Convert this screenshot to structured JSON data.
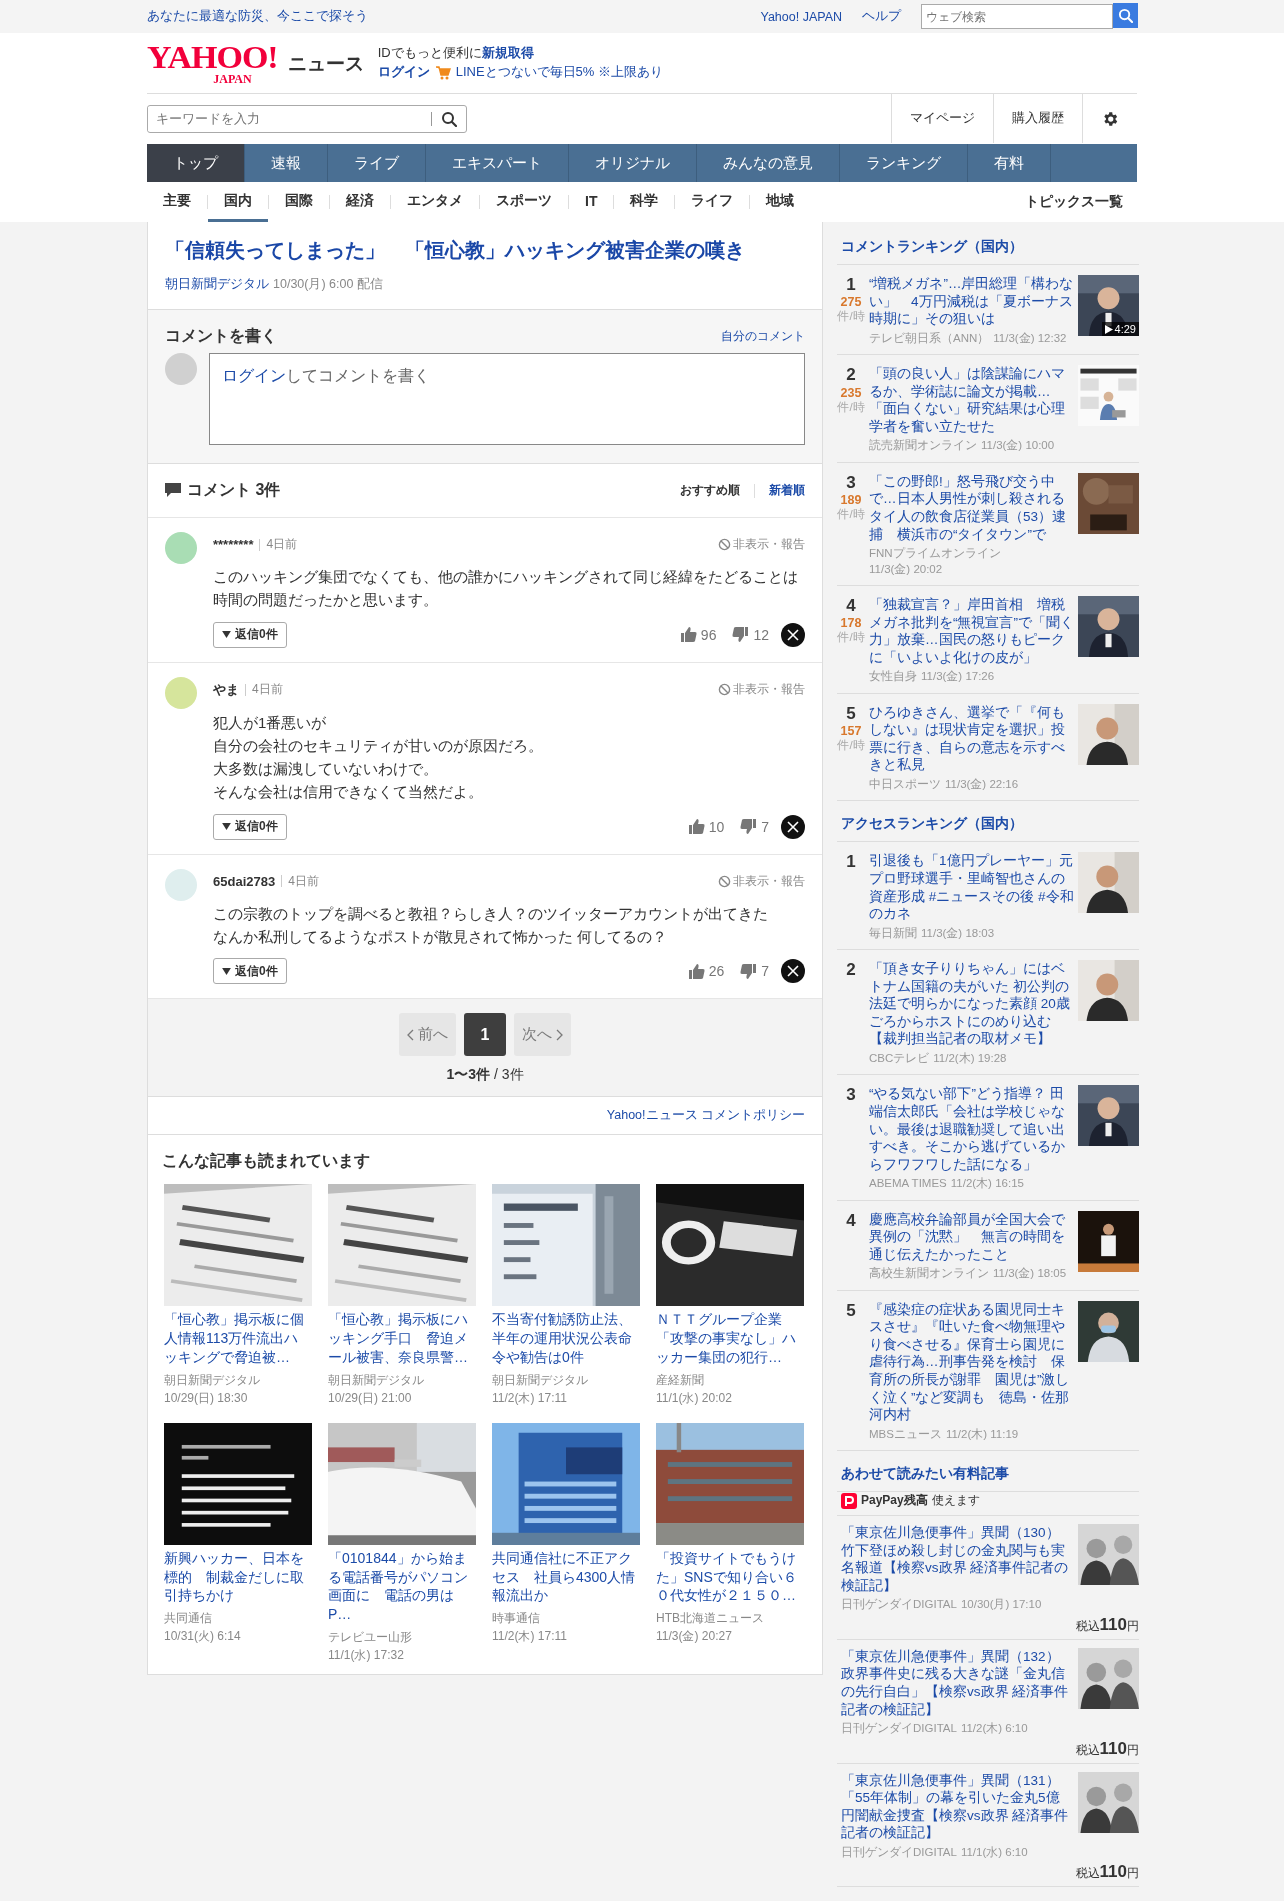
{
  "top_bar": {
    "tagline": "あなたに最適な防災、今ここで探そう",
    "links": [
      "Yahoo! JAPAN",
      "ヘルプ"
    ],
    "search": {
      "placeholder": "ウェブ検索"
    }
  },
  "header": {
    "logo_main": "YAHOO!",
    "logo_sub": "JAPAN",
    "service": "ニュース",
    "promo_text": "IDでもっと便利に",
    "promo_link": "新規取得",
    "login": "ログイン",
    "line_promo": "LINEとつないで毎日5% ※上限あり"
  },
  "search": {
    "placeholder": "キーワードを入力"
  },
  "user_links": [
    "マイページ",
    "購入履歴"
  ],
  "nav_tabs": [
    {
      "label": "トップ",
      "selected": true
    },
    {
      "label": "速報",
      "selected": false
    },
    {
      "label": "ライブ",
      "selected": false
    },
    {
      "label": "エキスパート",
      "selected": false
    },
    {
      "label": "オリジナル",
      "selected": false
    },
    {
      "label": "みんなの意見",
      "selected": false
    },
    {
      "label": "ランキング",
      "selected": false
    },
    {
      "label": "有料",
      "selected": false
    }
  ],
  "sub_tabs": [
    {
      "label": "主要",
      "selected": false
    },
    {
      "label": "国内",
      "selected": true
    },
    {
      "label": "国際",
      "selected": false
    },
    {
      "label": "経済",
      "selected": false
    },
    {
      "label": "エンタメ",
      "selected": false
    },
    {
      "label": "スポーツ",
      "selected": false
    },
    {
      "label": "IT",
      "selected": false
    },
    {
      "label": "科学",
      "selected": false
    },
    {
      "label": "ライフ",
      "selected": false
    },
    {
      "label": "地域",
      "selected": false
    }
  ],
  "topics_link": "トピックス一覧",
  "article": {
    "title": "「信頼失ってしまった」　「恒心教」ハッキング被害企業の嘆き",
    "source": "朝日新聞デジタル",
    "date": "10/30(月) 6:00 配信"
  },
  "comment_form": {
    "heading": "コメントを書く",
    "my_comments": "自分のコメント",
    "login_link": "ログイン",
    "prompt": "してコメントを書く"
  },
  "comments_header": {
    "title": "コメント 3件",
    "sorts": [
      {
        "label": "おすすめ順",
        "selected": true
      },
      {
        "label": "新着順",
        "selected": false
      }
    ]
  },
  "comments": [
    {
      "user": "********",
      "time": "4日前",
      "report": "非表示・報告",
      "lines": [
        "このハッキング集団でなくても、他の誰かにハッキングされて同じ経緯をたどることは時間の問題だったかと思います。"
      ],
      "replies": "返信0件",
      "likes": "96",
      "dislikes": "12",
      "color": "#a9ddb4"
    },
    {
      "user": "やま",
      "time": "4日前",
      "report": "非表示・報告",
      "lines": [
        "犯人が1番悪いが",
        "自分の会社のセキュリティが甘いのが原因だろ。",
        "大多数は漏洩していないわけで。",
        "そんな会社は信用できなくて当然だよ。"
      ],
      "replies": "返信0件",
      "likes": "10",
      "dislikes": "7",
      "color": "#d6e59c"
    },
    {
      "user": "65dai2783",
      "time": "4日前",
      "report": "非表示・報告",
      "lines": [
        "この宗教のトップを調べると教祖？らしき人？のツイッターアカウントが出てきた",
        "なんか私刑してるようなポストが散見されて怖かった 何してるの？"
      ],
      "replies": "返信0件",
      "likes": "26",
      "dislikes": "7",
      "color": "#dfeeee"
    }
  ],
  "pagination": {
    "prev": {
      "label": "前へ",
      "disabled": true
    },
    "pages": [
      {
        "label": "1",
        "selected": true
      }
    ],
    "next": {
      "label": "次へ",
      "disabled": true
    },
    "range": "1〜3件",
    "total": "/ 3件"
  },
  "policy_link": "Yahoo!ニュース コメントポリシー",
  "related": {
    "heading": "こんな記事も読まれています",
    "articles": [
      {
        "title": "「恒心教」掲示板に個人情報113万件流出ハッキングで脅迫被…",
        "source": "朝日新聞デジタル",
        "date": "10/29(日) 18:30"
      },
      {
        "title": "「恒心教」掲示板にハッキング手口　脅迫メール被害、奈良県警…",
        "source": "朝日新聞デジタル",
        "date": "10/29(日) 21:00"
      },
      {
        "title": "不当寄付勧誘防止法、半年の運用状況公表命令や勧告は0件",
        "source": "朝日新聞デジタル",
        "date": "11/2(木) 17:11"
      },
      {
        "title": "ＮＴＴグループ企業「攻撃の事実なし」ハッカー集団の犯行…",
        "source": "産経新聞",
        "date": "11/1(水) 20:02"
      },
      {
        "title": "新興ハッカー、日本を標的　制裁金だしに取引持ちかけ",
        "source": "共同通信",
        "date": "10/31(火) 6:14"
      },
      {
        "title": "「0101844」から始まる電話番号がパソコン画面に　電話の男はP…",
        "source": "テレビユー山形",
        "date": "11/1(水) 17:32"
      },
      {
        "title": "共同通信社に不正アクセス　社員ら4300人情報流出か",
        "source": "時事通信",
        "date": "11/2(木) 17:11"
      },
      {
        "title": "「投資サイトでもうけた」SNSで知り合い６０代女性が２１５０…",
        "source": "HTB北海道ニュース",
        "date": "11/3(金) 20:27"
      }
    ]
  },
  "comment_ranking": {
    "heading": "コメントランキング（国内）",
    "items": [
      {
        "rank": "1",
        "count": "275",
        "unit": "件/時",
        "title": "“増税メガネ”…岸田総理「構わない」　4万円減税は「夏ボーナス時期に」その狙いは",
        "source": "テレビ朝日系（ANN）",
        "date": "11/3(金) 12:32",
        "video_duration": "4:29"
      },
      {
        "rank": "2",
        "count": "235",
        "unit": "件/時",
        "title": "「頭の良い人」は陰謀論にハマるか、学術誌に論文が掲載…「面白くない」研究結果は心理学者を奮い立たせた",
        "source": "読売新聞オンライン",
        "date": "11/3(金) 10:00"
      },
      {
        "rank": "3",
        "count": "189",
        "unit": "件/時",
        "title": "「この野郎!」怒号飛び交う中で…日本人男性が刺し殺されるタイ人の飲食店従業員（53）逮捕　横浜市の“タイタウン”で",
        "source": "FNNプライムオンライン",
        "date": "11/3(金) 20:02"
      },
      {
        "rank": "4",
        "count": "178",
        "unit": "件/時",
        "title": "「独裁宣言？」岸田首相　増税メガネ批判を“無視宣言”で「聞く力」放棄…国民の怒りもピークに「いよいよ化けの皮が」",
        "source": "女性自身",
        "date": "11/3(金) 17:26"
      },
      {
        "rank": "5",
        "count": "157",
        "unit": "件/時",
        "title": "ひろゆきさん、選挙で「『何もしない』は現状肯定を選択」投票に行き、自らの意志を示すべきと私見",
        "source": "中日スポーツ",
        "date": "11/3(金) 22:16"
      }
    ]
  },
  "access_ranking": {
    "heading": "アクセスランキング（国内）",
    "items": [
      {
        "rank": "1",
        "title": "引退後も「1億円プレーヤー」元プロ野球選手・里崎智也さんの資産形成 #ニュースその後 #令和のカネ",
        "source": "毎日新聞",
        "date": "11/3(金) 18:03"
      },
      {
        "rank": "2",
        "title": "「頂き女子りりちゃん」にはベトナム国籍の夫がいた 初公判の法廷で明らかになった素顔 20歳ごろからホストにのめり込む【裁判担当記者の取材メモ】",
        "source": "CBCテレビ",
        "date": "11/2(木) 19:28"
      },
      {
        "rank": "3",
        "title": "“やる気ない部下”どう指導？ 田端信太郎氏「会社は学校じゃない。最後は退職勧奨して追い出すべき。そこから逃げているからフワフワした話になる」",
        "source": "ABEMA TIMES",
        "date": "11/2(木) 16:15"
      },
      {
        "rank": "4",
        "title": "慶應高校弁論部員が全国大会で異例の「沈黙」　無言の時間を通じ伝えたかったこと",
        "source": "高校生新聞オンライン",
        "date": "11/3(金) 18:05"
      },
      {
        "rank": "5",
        "title": "『感染症の症状ある園児同士キスさせ』『吐いた食べ物無理やり食べさせる』保育士ら園児に虐待行為…刑事告発を検討　保育所の所長が謝罪　園児は”激しく泣く”など変調も　徳島・佐那河内村",
        "source": "MBSニュース",
        "date": "11/2(木) 11:19"
      }
    ]
  },
  "paid_articles": {
    "heading": "あわせて読みたい有料記事",
    "paypay_brand": "PayPay残高",
    "paypay_text": "使えます",
    "items": [
      {
        "title": "「東京佐川急便事件」異聞（130）竹下登ほめ殺し封じの金丸関与も実名報道【検察vs政界 経済事件記者の検証記】",
        "source": "日刊ゲンダイDIGITAL",
        "date": "10/30(月) 17:10",
        "price_prefix": "税込",
        "price": "110",
        "currency": "円"
      },
      {
        "title": "「東京佐川急便事件」異聞（132）政界事件史に残る大きな謎「金丸信の先行自白」【検察vs政界 経済事件記者の検証記】",
        "source": "日刊ゲンダイDIGITAL",
        "date": "11/2(木) 6:10",
        "price_prefix": "税込",
        "price": "110",
        "currency": "円"
      },
      {
        "title": "「東京佐川急便事件」異聞（131）「55年体制」の幕を引いた金丸5億円闇献金捜査【検察vs政界 経済事件記者の検証記】",
        "source": "日刊ゲンダイDIGITAL",
        "date": "11/1(水) 6:10",
        "price_prefix": "税込",
        "price": "110",
        "currency": "円"
      }
    ]
  }
}
